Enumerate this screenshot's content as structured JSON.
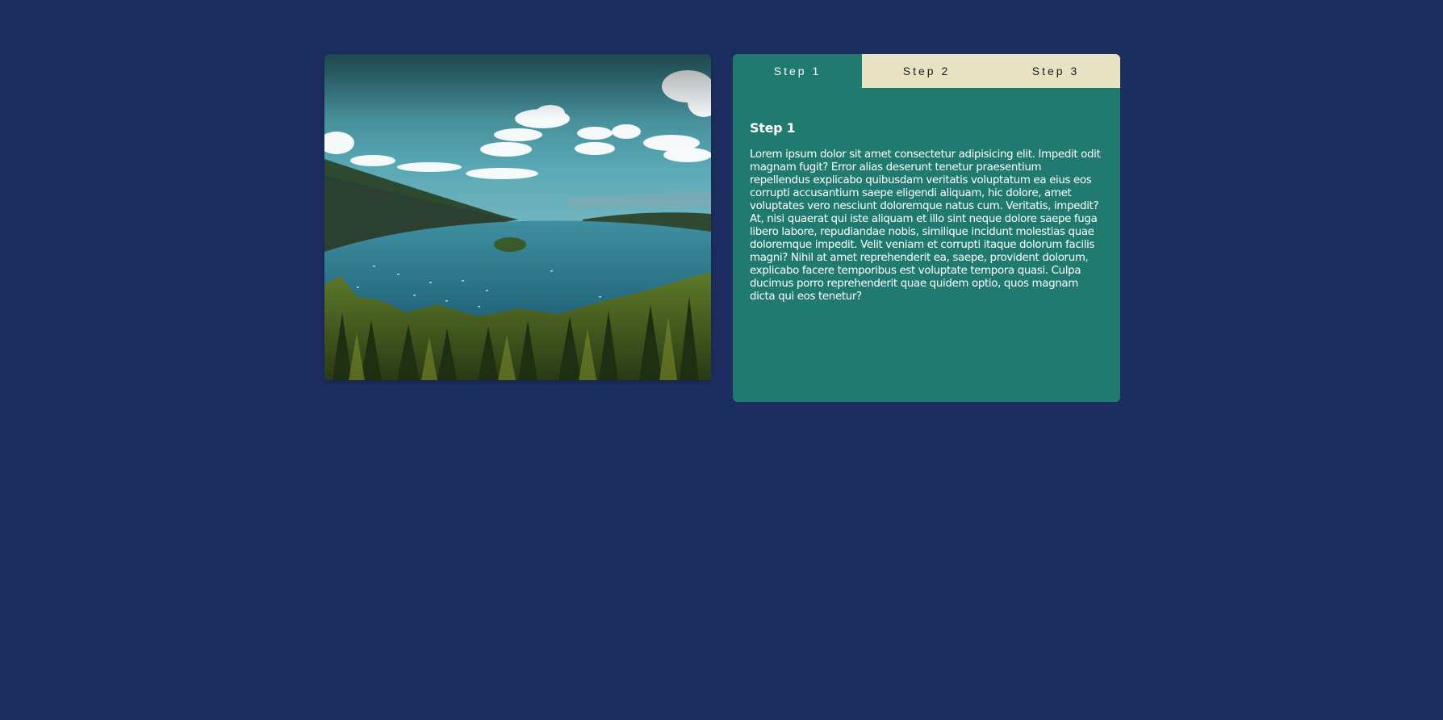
{
  "tabs": [
    {
      "label": "Step 1",
      "active": true
    },
    {
      "label": "Step 2",
      "active": false
    },
    {
      "label": "Step 3",
      "active": false
    }
  ],
  "content": {
    "heading": "Step 1",
    "body": "Lorem ipsum dolor sit amet consectetur adipisicing elit. Impedit odit magnam fugit? Error alias deserunt tenetur praesentium repellendus explicabo quibusdam veritatis voluptatum ea eius eos corrupti accusantium saepe eligendi aliquam, hic dolore, amet voluptates vero nesciunt doloremque natus cum. Veritatis, impedit? At, nisi quaerat qui iste aliquam et illo sint neque dolore saepe fuga libero labore, repudiandae nobis, similique incidunt molestias quae doloremque impedit. Velit veniam et corrupti itaque dolorum facilis magni? Nihil at amet reprehenderit ea, saepe, provident dolorum, explicabo facere temporibus est voluptate tempora quasi. Culpa ducimus porro reprehenderit quae quidem optio, quos magnam dicta qui eos tenetur?"
  },
  "colors": {
    "page_background": "#1c2e5f",
    "panel": "#217a6f",
    "tab_inactive": "#e8e2c4"
  },
  "image": {
    "subject": "lake-landscape-photo"
  }
}
